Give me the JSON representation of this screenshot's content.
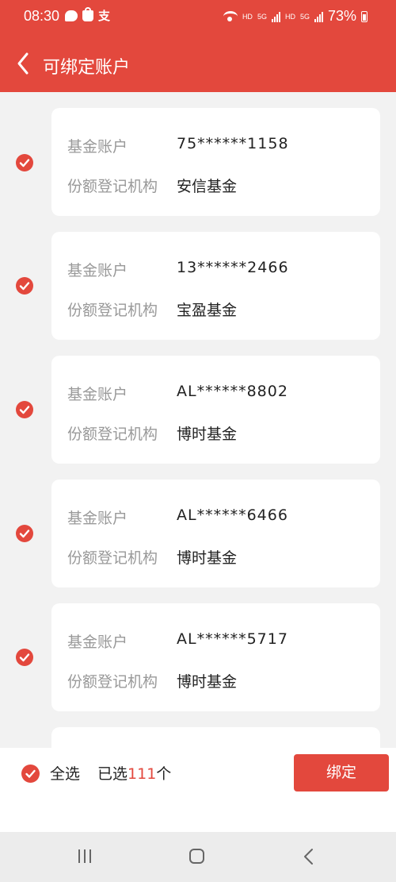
{
  "status_bar": {
    "time": "08:30",
    "icons": [
      "chat-bubble-icon",
      "shopping-bag-icon",
      "alipay-icon",
      "wifi-icon",
      "signal-5g-icon",
      "signal-5g-icon",
      "battery-icon"
    ],
    "zhi_glyph": "支",
    "hd1": "HD",
    "net1": "5G",
    "hd2": "HD",
    "net2": "5G",
    "battery": "73%"
  },
  "header": {
    "title": "可绑定账户",
    "background": "#e3483d"
  },
  "accounts": [
    {
      "account_label": "基金账户",
      "account_no": "75******1158",
      "registrar_label": "份额登记机构",
      "registrar": "安信基金",
      "checked": true
    },
    {
      "account_label": "基金账户",
      "account_no": "13******2466",
      "registrar_label": "份额登记机构",
      "registrar": "宝盈基金",
      "checked": true
    },
    {
      "account_label": "基金账户",
      "account_no": "AL******8802",
      "registrar_label": "份额登记机构",
      "registrar": "博时基金",
      "checked": true
    },
    {
      "account_label": "基金账户",
      "account_no": "AL******6466",
      "registrar_label": "份额登记机构",
      "registrar": "博时基金",
      "checked": true
    },
    {
      "account_label": "基金账户",
      "account_no": "AL******5717",
      "registrar_label": "份额登记机构",
      "registrar": "博时基金",
      "checked": true
    }
  ],
  "footer": {
    "select_all_label": "全选",
    "select_all_checked": true,
    "selected_prefix": "已选",
    "selected_count": "111",
    "selected_suffix": "个",
    "bind_label": "绑定"
  },
  "nav_bar": {
    "icons": [
      "recent-apps-icon",
      "home-icon",
      "back-icon"
    ]
  },
  "colors": {
    "accent": "#e3483d",
    "background": "#f2f2f2",
    "card": "#ffffff",
    "label_gray": "#999999"
  }
}
